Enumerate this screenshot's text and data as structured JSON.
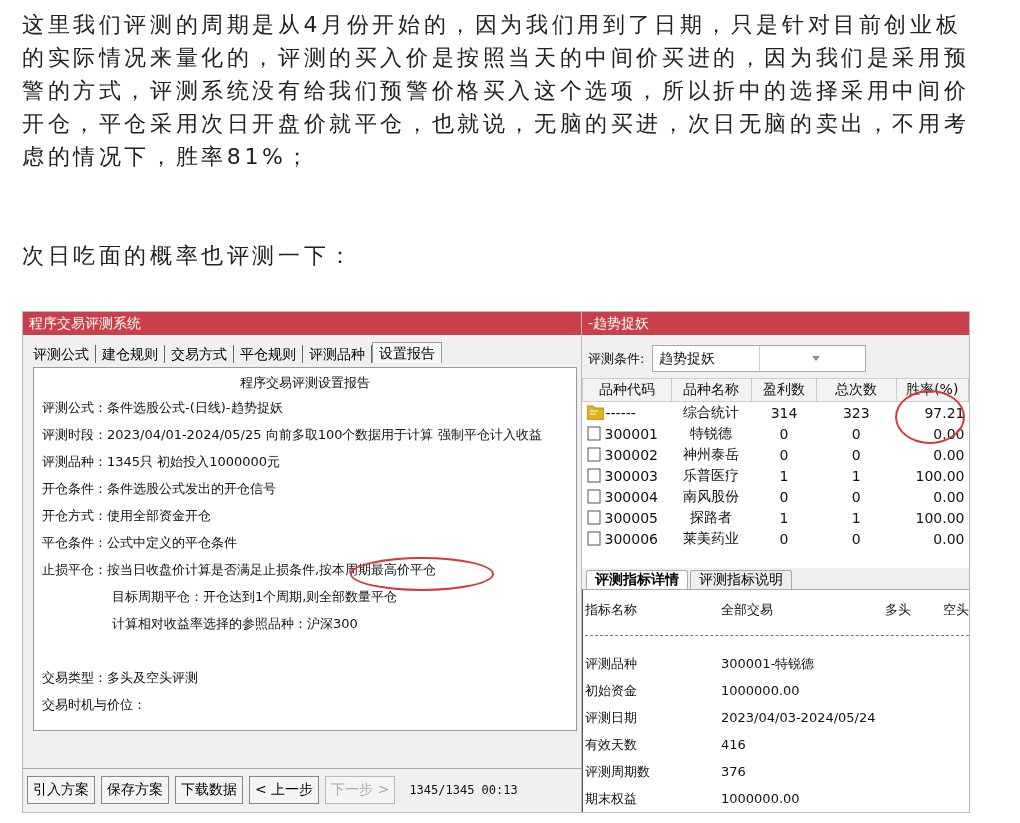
{
  "article": {
    "paragraphs": [
      "这里我们评测的周期是从4月份开始的，因为我们用到了日期，只是针对目前创业板的实际情况来量化的，评测的买入价是按照当天的中间价买进的，因为我们是采用预警的方式，评测系统没有给我们预警价格买入这个选项，所以折中的选择采用中间价开仓，平仓采用次日开盘价就平仓，也就说，无脑的买进，次日无脑的卖出，不用考虑的情况下，胜率81%；",
      "次日吃面的概率也评测一下："
    ]
  },
  "eval_window": {
    "title": "程序交易评测系统",
    "tabs": [
      {
        "label": "评测公式",
        "selected": false
      },
      {
        "label": "建仓规则",
        "selected": false
      },
      {
        "label": "交易方式",
        "selected": false
      },
      {
        "label": "平仓规则",
        "selected": false
      },
      {
        "label": "评测品种",
        "selected": false
      },
      {
        "label": "设置报告",
        "selected": true
      }
    ],
    "report": {
      "heading": "程序交易评测设置报告",
      "lines": [
        {
          "kind": "field",
          "text": "评测公式：条件选股公式-(日线)-趋势捉妖"
        },
        {
          "kind": "field",
          "text": "评测时段：2023/04/01-2024/05/25 向前多取100个数据用于计算 强制平仓计入收益"
        },
        {
          "kind": "field",
          "text": "评测品种：1345只 初始投入1000000元"
        },
        {
          "kind": "field",
          "text": "开仓条件：条件选股公式发出的开仓信号"
        },
        {
          "kind": "field",
          "text": "开仓方式：使用全部资金开仓"
        },
        {
          "kind": "field",
          "text": "平仓条件：公式中定义的平仓条件"
        },
        {
          "kind": "field",
          "text": "止损平仓：按当日收盘价计算是否满足止损条件,按本周期最高价平仓"
        },
        {
          "kind": "sub",
          "text": "目标周期平仓：开仓达到1个周期,则全部数量平仓"
        },
        {
          "kind": "sub",
          "text": "计算相对收益率选择的参照品种：沪深300"
        },
        {
          "kind": "section",
          "text": "交易类型：多头及空头评测"
        },
        {
          "kind": "field",
          "text": "交易时机与价位："
        }
      ]
    },
    "buttons": [
      {
        "label": "引入方案",
        "disabled": false
      },
      {
        "label": "保存方案",
        "disabled": false
      },
      {
        "label": "下载数据",
        "disabled": false
      },
      {
        "label": "< 上一步",
        "disabled": false
      },
      {
        "label": "下一步 >",
        "disabled": true
      }
    ],
    "status": "1345/1345 00:13"
  },
  "result_window": {
    "title": "-趋势捉妖",
    "condition_label": "评测条件:",
    "condition_value": "趋势捉妖",
    "table": {
      "columns": [
        "品种代码",
        "品种名称",
        "盈利数",
        "总次数",
        "胜率(%)"
      ],
      "rows": [
        {
          "kind": "summary",
          "cells": [
            "------",
            "综合统计",
            "314",
            "323",
            "97.21"
          ]
        },
        {
          "kind": "item",
          "cells": [
            "300001",
            "特锐德",
            "0",
            "0",
            "0.00"
          ]
        },
        {
          "kind": "item",
          "cells": [
            "300002",
            "神州泰岳",
            "0",
            "0",
            "0.00"
          ]
        },
        {
          "kind": "item",
          "cells": [
            "300003",
            "乐普医疗",
            "1",
            "1",
            "100.00"
          ]
        },
        {
          "kind": "item",
          "cells": [
            "300004",
            "南风股份",
            "0",
            "0",
            "0.00"
          ]
        },
        {
          "kind": "item",
          "cells": [
            "300005",
            "探路者",
            "1",
            "1",
            "100.00"
          ]
        },
        {
          "kind": "item",
          "cells": [
            "300006",
            "莱美药业",
            "0",
            "0",
            "0.00"
          ]
        }
      ]
    },
    "tabs": [
      {
        "label": "评测指标详情",
        "selected": true
      },
      {
        "label": "评测指标说明",
        "selected": false
      }
    ],
    "detail": {
      "columns": [
        "指标名称",
        "全部交易",
        "多头",
        "空头"
      ],
      "rows": [
        [
          "评测品种",
          "300001-特锐德"
        ],
        [
          "初始资金",
          "1000000.00"
        ],
        [
          "评测日期",
          "2023/04/03-2024/05/24"
        ],
        [
          "有效天数",
          "416"
        ],
        [
          "评测周期数",
          "376"
        ],
        [
          "期末权益",
          "1000000.00"
        ]
      ]
    }
  }
}
